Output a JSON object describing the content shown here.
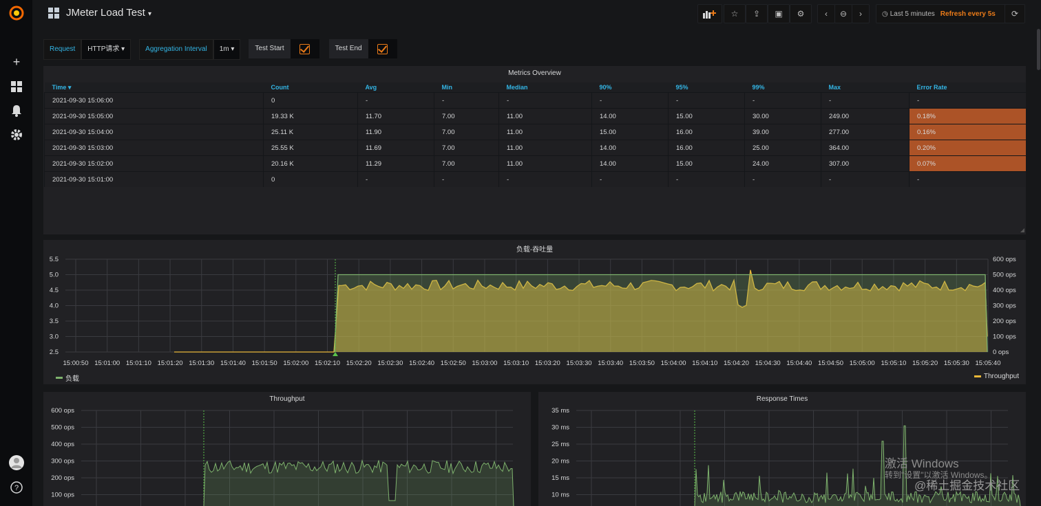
{
  "header": {
    "dashboard_title": "JMeter Load Test",
    "time_range": "Last 5 minutes",
    "refresh": "Refresh every 5s"
  },
  "sidebar": {
    "icons": [
      "grafana-logo-icon",
      "plus-icon",
      "dashboards-icon",
      "bell-icon",
      "gear-icon",
      "user-avatar-icon",
      "help-icon"
    ]
  },
  "variables": {
    "request_label": "Request",
    "request_value": "HTTP请求",
    "interval_label": "Aggregation Interval",
    "interval_value": "1m",
    "test_start_label": "Test Start",
    "test_end_label": "Test End"
  },
  "metrics_panel": {
    "title": "Metrics Overview",
    "columns": [
      "Time",
      "Count",
      "Avg",
      "Min",
      "Median",
      "90%",
      "95%",
      "99%",
      "Max",
      "Error Rate"
    ],
    "rows": [
      [
        "2021-09-30 15:06:00",
        "0",
        "-",
        "-",
        "-",
        "-",
        "-",
        "-",
        "-",
        "-"
      ],
      [
        "2021-09-30 15:05:00",
        "19.33 K",
        "11.70",
        "7.00",
        "11.00",
        "14.00",
        "15.00",
        "30.00",
        "249.00",
        "0.18%"
      ],
      [
        "2021-09-30 15:04:00",
        "25.11 K",
        "11.90",
        "7.00",
        "11.00",
        "15.00",
        "16.00",
        "39.00",
        "277.00",
        "0.16%"
      ],
      [
        "2021-09-30 15:03:00",
        "25.55 K",
        "11.69",
        "7.00",
        "11.00",
        "14.00",
        "16.00",
        "25.00",
        "364.00",
        "0.20%"
      ],
      [
        "2021-09-30 15:02:00",
        "20.16 K",
        "11.29",
        "7.00",
        "11.00",
        "14.00",
        "15.00",
        "24.00",
        "307.00",
        "0.07%"
      ],
      [
        "2021-09-30 15:01:00",
        "0",
        "-",
        "-",
        "-",
        "-",
        "-",
        "-",
        "-",
        "-"
      ]
    ]
  },
  "chart_data": [
    {
      "type": "line",
      "title": "负载-吞吐量",
      "x_ticks": [
        "15:00:50",
        "15:01:00",
        "15:01:10",
        "15:01:20",
        "15:01:30",
        "15:01:40",
        "15:01:50",
        "15:02:00",
        "15:02:10",
        "15:02:20",
        "15:02:30",
        "15:02:40",
        "15:02:50",
        "15:03:00",
        "15:03:10",
        "15:03:20",
        "15:03:30",
        "15:03:40",
        "15:03:50",
        "15:04:00",
        "15:04:10",
        "15:04:20",
        "15:04:30",
        "15:04:40",
        "15:04:50",
        "15:05:00",
        "15:05:10",
        "15:05:20",
        "15:05:30",
        "15:05:40"
      ],
      "y_left_ticks": [
        "2.5",
        "3.0",
        "3.5",
        "4.0",
        "4.5",
        "5.0",
        "5.5"
      ],
      "y_right_ticks": [
        "0 ops",
        "100 ops",
        "200 ops",
        "300 ops",
        "400 ops",
        "500 ops",
        "600 ops"
      ],
      "ylim_left": [
        2.5,
        5.5
      ],
      "ylim_right": [
        0,
        600
      ],
      "series": [
        {
          "name": "负载",
          "color": "#7eb26d",
          "axis": "left",
          "values": [
            [
              15.017,
              2.5
            ],
            [
              15.035,
              2.5
            ],
            [
              15.036,
              5.0
            ],
            [
              15.096,
              5.0
            ],
            [
              15.097,
              2.5
            ]
          ]
        },
        {
          "name": "Throughput",
          "color": "#eab839",
          "axis": "right",
          "values": [
            [
              15.02,
              0
            ],
            [
              15.035,
              0
            ],
            [
              15.037,
              500
            ],
            [
              15.097,
              480
            ],
            [
              15.098,
              100
            ]
          ]
        }
      ],
      "legend": "bottom"
    },
    {
      "type": "area",
      "title": "Throughput",
      "y_ticks": [
        "100 ops",
        "200 ops",
        "300 ops",
        "400 ops",
        "500 ops",
        "600 ops"
      ],
      "ylim": [
        100,
        600
      ],
      "series": [
        {
          "color": "#7eb26d",
          "values": [
            [
              0,
              100
            ],
            [
              1,
              450
            ],
            [
              2,
              420
            ],
            [
              3,
              460
            ],
            [
              4,
              400
            ],
            [
              5,
              470
            ],
            [
              6,
              440
            ]
          ]
        }
      ]
    },
    {
      "type": "area",
      "title": "Response Times",
      "y_ticks": [
        "10 ms",
        "15 ms",
        "20 ms",
        "25 ms",
        "30 ms",
        "35 ms"
      ],
      "ylim": [
        10,
        35
      ],
      "series": [
        {
          "color": "#7eb26d",
          "values": [
            [
              0,
              12
            ],
            [
              1,
              13
            ],
            [
              2,
              18
            ],
            [
              3,
              14
            ],
            [
              4,
              31
            ],
            [
              5,
              16
            ]
          ]
        }
      ]
    }
  ],
  "watermark": {
    "line1": "激活 Windows",
    "line2": "转到\"设置\"以激活 Windows。",
    "line3": "@稀土掘金技术社区"
  }
}
